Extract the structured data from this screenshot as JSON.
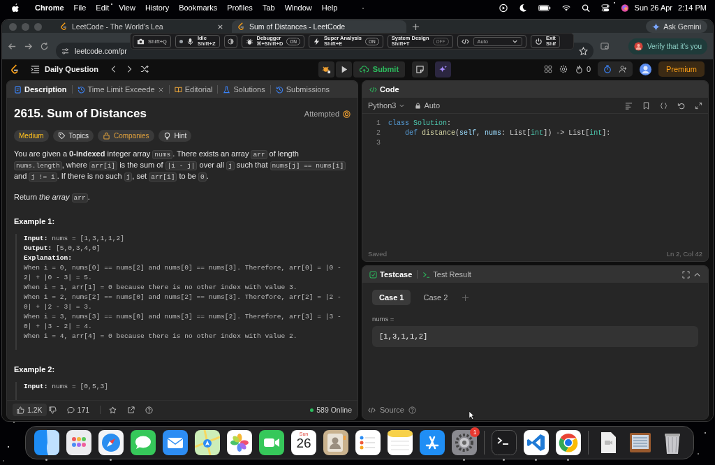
{
  "menubar": {
    "app": "Chrome",
    "menus": [
      "File",
      "Edit",
      "View",
      "History",
      "Bookmarks",
      "Profiles",
      "Tab",
      "Window",
      "Help"
    ],
    "date": "Sun 26 Apr",
    "time": "2:14 PM"
  },
  "browser": {
    "tabs": [
      {
        "title": "LeetCode - The World's Lea",
        "selected": false
      },
      {
        "title": "Sum of Distances - LeetCode",
        "selected": true
      }
    ],
    "ask": "Ask Gemini",
    "url": "leetcode.com/pr",
    "verify": "Verify that it's you"
  },
  "extension_bar": {
    "items": [
      {
        "kind": "camera",
        "shortcut": "Shift+Q"
      },
      {
        "kind": "mic",
        "label": "Idle",
        "shortcut": "Shift+Z"
      },
      {
        "kind": "theme"
      },
      {
        "kind": "bug",
        "label": "Debugger",
        "shortcut": "⌘+Shift+D",
        "toggle": "ON",
        "on": true
      },
      {
        "kind": "bolt",
        "label": "Super Analysis",
        "shortcut": "Shift+E",
        "toggle": "ON",
        "on": true
      },
      {
        "kind": "plain",
        "label": "System Design",
        "shortcut": "Shift+T",
        "toggle": "OFF",
        "on": false
      },
      {
        "kind": "select",
        "value": "Auto"
      },
      {
        "kind": "power",
        "label": "Exit",
        "shortcut": "Shif"
      }
    ]
  },
  "header": {
    "title": "Daily Question",
    "submit": "Submit",
    "streak": "0",
    "premium": "Premium"
  },
  "left_panel": {
    "tabs": [
      {
        "kind": "description",
        "label": "Description",
        "selected": true,
        "closable": false
      },
      {
        "kind": "history",
        "label": "Time Limit Exceede",
        "selected": false,
        "closable": true
      },
      {
        "kind": "editorial",
        "label": "Editorial",
        "selected": false,
        "closable": false
      },
      {
        "kind": "solutions",
        "label": "Solutions",
        "selected": false,
        "closable": false
      },
      {
        "kind": "submissions",
        "label": "Submissions",
        "selected": false,
        "closable": false
      }
    ],
    "title": "2615. Sum of Distances",
    "status": "Attempted",
    "tags": [
      {
        "kind": "difficulty",
        "label": "Medium"
      },
      {
        "kind": "topics",
        "label": "Topics"
      },
      {
        "kind": "companies",
        "label": "Companies"
      },
      {
        "kind": "hint",
        "label": "Hint"
      }
    ],
    "paragraphs": [
      {
        "segments": [
          {
            "kind": "text",
            "text": "You are given a **0-indexed** integer array "
          },
          {
            "kind": "code",
            "text": "nums"
          },
          {
            "kind": "text",
            "text": ". There exists an array "
          },
          {
            "kind": "code",
            "text": "arr"
          },
          {
            "kind": "text",
            "text": " of length "
          },
          {
            "kind": "code",
            "text": "nums.length"
          },
          {
            "kind": "text",
            "text": ", where "
          },
          {
            "kind": "code",
            "text": "arr[i]"
          },
          {
            "kind": "text",
            "text": " is the sum of "
          },
          {
            "kind": "code",
            "text": "|i - j|"
          },
          {
            "kind": "text",
            "text": " over all "
          },
          {
            "kind": "code",
            "text": "j"
          },
          {
            "kind": "text",
            "text": " such that "
          },
          {
            "kind": "code",
            "text": "nums[j] == nums[i]"
          },
          {
            "kind": "text",
            "text": " and "
          },
          {
            "kind": "code",
            "text": "j != i"
          },
          {
            "kind": "text",
            "text": ". If there is no such "
          },
          {
            "kind": "code",
            "text": "j"
          },
          {
            "kind": "text",
            "text": ", set "
          },
          {
            "kind": "code",
            "text": "arr[i]"
          },
          {
            "kind": "text",
            "text": " to be "
          },
          {
            "kind": "code",
            "text": "0"
          },
          {
            "kind": "text",
            "text": "."
          }
        ]
      },
      {
        "segments": [
          {
            "kind": "text",
            "text": "Return *the array* "
          },
          {
            "kind": "code",
            "text": "arr"
          },
          {
            "kind": "text",
            "text": "."
          }
        ]
      }
    ],
    "examples": [
      {
        "title": "Example 1:",
        "lines": [
          "**Input:** nums = [1,3,1,1,2]",
          "**Output:** [5,0,3,4,0]",
          "**Explanation:**",
          "When i = 0, nums[0] == nums[2] and nums[0] == nums[3]. Therefore, arr[0] = |0 - 2| + |0 - 3| = 5.",
          "When i = 1, arr[1] = 0 because there is no other index with value 3.",
          "When i = 2, nums[2] == nums[0] and nums[2] == nums[3]. Therefore, arr[2] = |2 - 0| + |2 - 3| = 3.",
          "When i = 3, nums[3] == nums[0] and nums[3] == nums[2]. Therefore, arr[3] = |3 - 0| + |3 - 2| = 4.",
          "When i = 4, arr[4] = 0 because there is no other index with value 2."
        ]
      },
      {
        "title": "Example 2:",
        "lines": [
          "**Input:** nums = [0,5,3]"
        ]
      }
    ],
    "footer": {
      "likes": "1.2K",
      "comments": "171",
      "online": "589 Online"
    }
  },
  "code_panel": {
    "title": "Code",
    "language": "Python3",
    "mode": "Auto",
    "lines": [
      {
        "number": "1",
        "tokens": [
          {
            "kind": "keyword",
            "text": "class"
          },
          {
            "kind": "class",
            "text": " Solution"
          },
          {
            "kind": "plain",
            "text": ":"
          }
        ]
      },
      {
        "number": "2",
        "tokens": [
          {
            "kind": "keyword",
            "text": "    def"
          },
          {
            "kind": "function",
            "text": " distance"
          },
          {
            "kind": "plain",
            "text": "("
          },
          {
            "kind": "param",
            "text": "self"
          },
          {
            "kind": "plain",
            "text": ", "
          },
          {
            "kind": "param",
            "text": "nums"
          },
          {
            "kind": "plain",
            "text": ": List["
          },
          {
            "kind": "builtin",
            "text": "int"
          },
          {
            "kind": "plain",
            "text": "]) -> List["
          },
          {
            "kind": "builtin",
            "text": "int"
          },
          {
            "kind": "plain",
            "text": "]:"
          }
        ]
      },
      {
        "number": "3"
      }
    ],
    "saved": "Saved",
    "cursor": "Ln 2, Col 42"
  },
  "test_panel": {
    "tabs": [
      {
        "kind": "testcase",
        "label": "Testcase",
        "selected": true
      },
      {
        "kind": "result",
        "label": "Test Result",
        "selected": false
      }
    ],
    "cases": [
      {
        "label": "Case 1",
        "selected": true
      },
      {
        "label": "Case 2",
        "selected": false
      }
    ],
    "param": "nums =",
    "value": "[1,3,1,1,2]",
    "source": "Source"
  },
  "dock": {
    "groups": [
      [
        {
          "kind": "finder",
          "running": true
        },
        {
          "kind": "launchpad",
          "running": false
        },
        {
          "kind": "safari",
          "running": true
        },
        {
          "kind": "messages",
          "running": false
        },
        {
          "kind": "mail",
          "running": false
        },
        {
          "kind": "maps",
          "running": false
        },
        {
          "kind": "photos",
          "running": false
        },
        {
          "kind": "facetime",
          "running": false
        },
        {
          "kind": "calendar",
          "running": false,
          "weekday": "Sun",
          "day": "26"
        },
        {
          "kind": "contacts",
          "running": false
        },
        {
          "kind": "reminders",
          "running": false
        },
        {
          "kind": "notes",
          "running": false
        },
        {
          "kind": "appstore",
          "running": false
        },
        {
          "kind": "settings",
          "running": true,
          "badge": "1"
        }
      ],
      [
        {
          "kind": "terminal",
          "running": true
        },
        {
          "kind": "vscode",
          "running": true
        },
        {
          "kind": "chrome",
          "running": true
        }
      ],
      [
        {
          "kind": "video",
          "running": false
        },
        {
          "kind": "drawer",
          "running": false
        },
        {
          "kind": "trash",
          "running": false
        }
      ]
    ]
  }
}
